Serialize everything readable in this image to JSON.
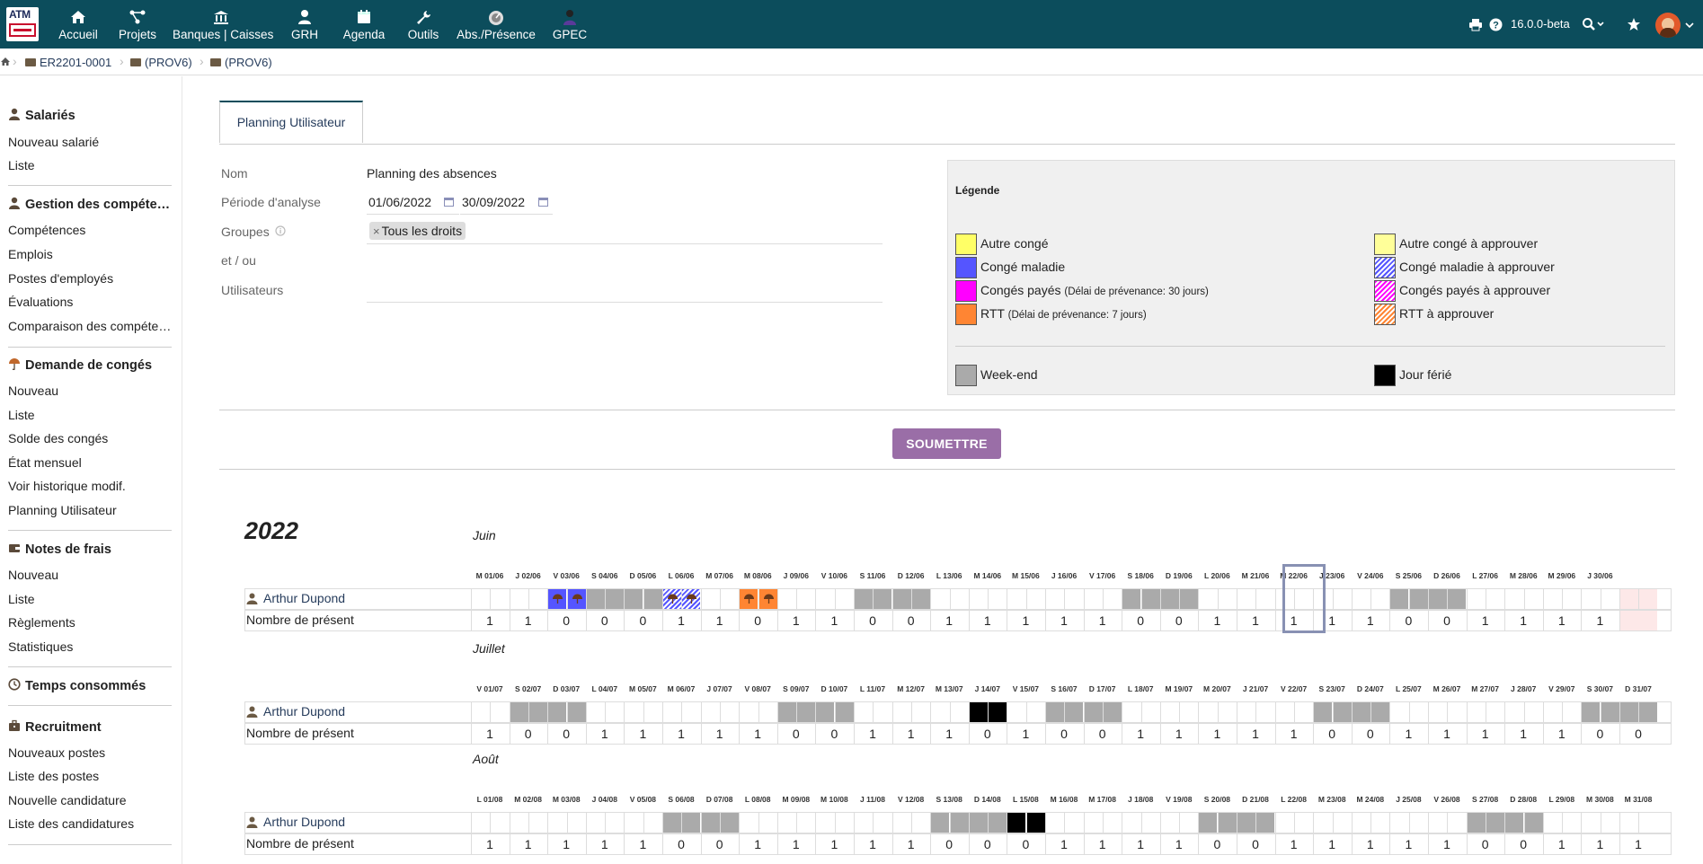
{
  "topbar": {
    "logo_text": "ATM",
    "menu": [
      {
        "label": "Accueil",
        "icon": "home-icon"
      },
      {
        "label": "Projets",
        "icon": "projects-icon"
      },
      {
        "label": "Banques | Caisses",
        "icon": "bank-icon"
      },
      {
        "label": "GRH",
        "icon": "user-icon"
      },
      {
        "label": "Agenda",
        "icon": "calendar-icon"
      },
      {
        "label": "Outils",
        "icon": "wrench-icon"
      },
      {
        "label": "Abs./Présence",
        "icon": "gauge-icon"
      },
      {
        "label": "GPEC",
        "icon": "gpec-icon"
      }
    ],
    "version": "16.0.0-beta",
    "right_icons": [
      "print-icon",
      "help-icon",
      "search-icon",
      "star-icon",
      "avatar"
    ]
  },
  "breadcrumb": [
    "ER2201-0001",
    "(PROV6)",
    "(PROV6)"
  ],
  "leftmenu": {
    "sections": [
      {
        "title": "Salariés",
        "icon": "user-icon",
        "items": [
          "Nouveau salarié",
          "Liste"
        ]
      },
      {
        "title": "Gestion des compétences",
        "icon": "user-icon",
        "items": [
          "Compétences",
          "Emplois",
          "Postes d'employés",
          "Évaluations",
          "Comparaison des compétences"
        ]
      },
      {
        "title": "Demande de congés",
        "icon": "umbrella-icon",
        "items": [
          "Nouveau",
          "Liste",
          "Solde des congés",
          "État mensuel",
          "Voir historique modif.",
          "Planning Utilisateur"
        ]
      },
      {
        "title": "Notes de frais",
        "icon": "wallet-icon",
        "items": [
          "Nouveau",
          "Liste",
          "Règlements",
          "Statistiques"
        ]
      },
      {
        "title": "Temps consommés",
        "icon": "clock-icon",
        "items": []
      },
      {
        "title": "Recruitment",
        "icon": "briefcase-icon",
        "items": [
          "Nouveaux postes",
          "Liste des postes",
          "Nouvelle candidature",
          "Liste des candidatures"
        ]
      }
    ]
  },
  "tab": {
    "label": "Planning Utilisateur"
  },
  "form": {
    "nom_label": "Nom",
    "nom_value": "Planning des absences",
    "periode_label": "Période d'analyse",
    "date_start": "01/06/2022",
    "date_end": "30/09/2022",
    "groupes_label": "Groupes",
    "groupes_tag": "Tous les droits",
    "etou_label": "et / ou",
    "users_label": "Utilisateurs"
  },
  "legend": {
    "title": "Légende",
    "items": [
      {
        "label": "Autre congé",
        "note": "",
        "color": "#ffff66"
      },
      {
        "label": "Congé maladie",
        "note": "",
        "color": "#5555ff"
      },
      {
        "label": "Congés payés",
        "note": "(Délai de prévenance: 30 jours)",
        "color": "#ff00ff"
      },
      {
        "label": "RTT",
        "note": "(Délai de prévenance: 7 jours)",
        "color": "#ff8533"
      },
      {
        "label": "Autre congé à approuver",
        "note": "",
        "color": "#ffff99"
      },
      {
        "label": "Congé maladie à approuver",
        "note": "",
        "color": "#5555ff"
      },
      {
        "label": "Congés payés à approuver",
        "note": "",
        "color": "#ff00ff"
      },
      {
        "label": "RTT à approuver",
        "note": "",
        "color": "#ff8533"
      },
      {
        "label": "Week-end",
        "note": "",
        "color": "#aaaaaa"
      },
      {
        "label": "Jour férié",
        "note": "",
        "color": "#000000"
      }
    ]
  },
  "submit_label": "SOUMETTRE",
  "year": "2022",
  "planning": {
    "user_name": "Arthur Dupond",
    "count_label": "Nombre de présent",
    "months": [
      {
        "name": "Juin",
        "days": [
          "M 01/06",
          "J 02/06",
          "V 03/06",
          "S 04/06",
          "D 05/06",
          "L 06/06",
          "M 07/06",
          "M 08/06",
          "J 09/06",
          "V 10/06",
          "S 11/06",
          "D 12/06",
          "L 13/06",
          "M 14/06",
          "M 15/06",
          "J 16/06",
          "V 17/06",
          "S 18/06",
          "D 19/06",
          "L 20/06",
          "M 21/06",
          "M 22/06",
          "J 23/06",
          "V 24/06",
          "S 25/06",
          "D 26/06",
          "L 27/06",
          "M 28/06",
          "M 29/06",
          "J 30/06",
          ""
        ],
        "counts": [
          "1",
          "1",
          "0",
          "0",
          "0",
          "1",
          "1",
          "0",
          "1",
          "1",
          "0",
          "0",
          "1",
          "1",
          "1",
          "1",
          "1",
          "0",
          "0",
          "1",
          "1",
          "1",
          "1",
          "1",
          "0",
          "0",
          "1",
          "1",
          "1",
          "1",
          ""
        ],
        "status": [
          "",
          "",
          "sick",
          "wk",
          "wk",
          "sickpend-half",
          "",
          "rtt",
          "",
          "",
          "wk",
          "wk",
          "",
          "",
          "",
          "",
          "",
          "wk",
          "wk",
          "",
          "",
          "",
          "",
          "",
          "wk",
          "wk",
          "",
          "",
          "",
          "",
          "past"
        ]
      },
      {
        "name": "Juillet",
        "days": [
          "V 01/07",
          "S 02/07",
          "D 03/07",
          "L 04/07",
          "M 05/07",
          "M 06/07",
          "J 07/07",
          "V 08/07",
          "S 09/07",
          "D 10/07",
          "L 11/07",
          "M 12/07",
          "M 13/07",
          "J 14/07",
          "V 15/07",
          "S 16/07",
          "D 17/07",
          "L 18/07",
          "M 19/07",
          "M 20/07",
          "J 21/07",
          "V 22/07",
          "S 23/07",
          "D 24/07",
          "L 25/07",
          "M 26/07",
          "M 27/07",
          "J 28/07",
          "V 29/07",
          "S 30/07",
          "D 31/07"
        ],
        "counts": [
          "1",
          "0",
          "0",
          "1",
          "1",
          "1",
          "1",
          "1",
          "0",
          "0",
          "1",
          "1",
          "1",
          "0",
          "1",
          "0",
          "0",
          "1",
          "1",
          "1",
          "1",
          "1",
          "0",
          "0",
          "1",
          "1",
          "1",
          "1",
          "1",
          "0",
          "0"
        ],
        "status": [
          "",
          "wk",
          "wk",
          "",
          "",
          "",
          "",
          "",
          "wk",
          "wk",
          "",
          "",
          "",
          "hol",
          "",
          "wk",
          "wk",
          "",
          "",
          "",
          "",
          "",
          "wk",
          "wk",
          "",
          "",
          "",
          "",
          "",
          "wk",
          "wk"
        ]
      },
      {
        "name": "Août",
        "days": [
          "L 01/08",
          "M 02/08",
          "M 03/08",
          "J 04/08",
          "V 05/08",
          "S 06/08",
          "D 07/08",
          "L 08/08",
          "M 09/08",
          "M 10/08",
          "J 11/08",
          "V 12/08",
          "S 13/08",
          "D 14/08",
          "L 15/08",
          "M 16/08",
          "M 17/08",
          "J 18/08",
          "V 19/08",
          "S 20/08",
          "D 21/08",
          "L 22/08",
          "M 23/08",
          "M 24/08",
          "J 25/08",
          "V 26/08",
          "S 27/08",
          "D 28/08",
          "L 29/08",
          "M 30/08",
          "M 31/08"
        ],
        "counts": [
          "1",
          "1",
          "1",
          "1",
          "1",
          "0",
          "0",
          "1",
          "1",
          "1",
          "1",
          "1",
          "0",
          "0",
          "0",
          "1",
          "1",
          "1",
          "1",
          "0",
          "0",
          "1",
          "1",
          "1",
          "1",
          "1",
          "0",
          "0",
          "1",
          "1",
          "1"
        ],
        "status": [
          "",
          "",
          "",
          "",
          "",
          "wk",
          "wk",
          "",
          "",
          "",
          "",
          "",
          "wk",
          "wk",
          "hol",
          "",
          "",
          "",
          "",
          "wk",
          "wk",
          "",
          "",
          "",
          "",
          "",
          "wk",
          "wk",
          "",
          "",
          ""
        ]
      }
    ]
  }
}
